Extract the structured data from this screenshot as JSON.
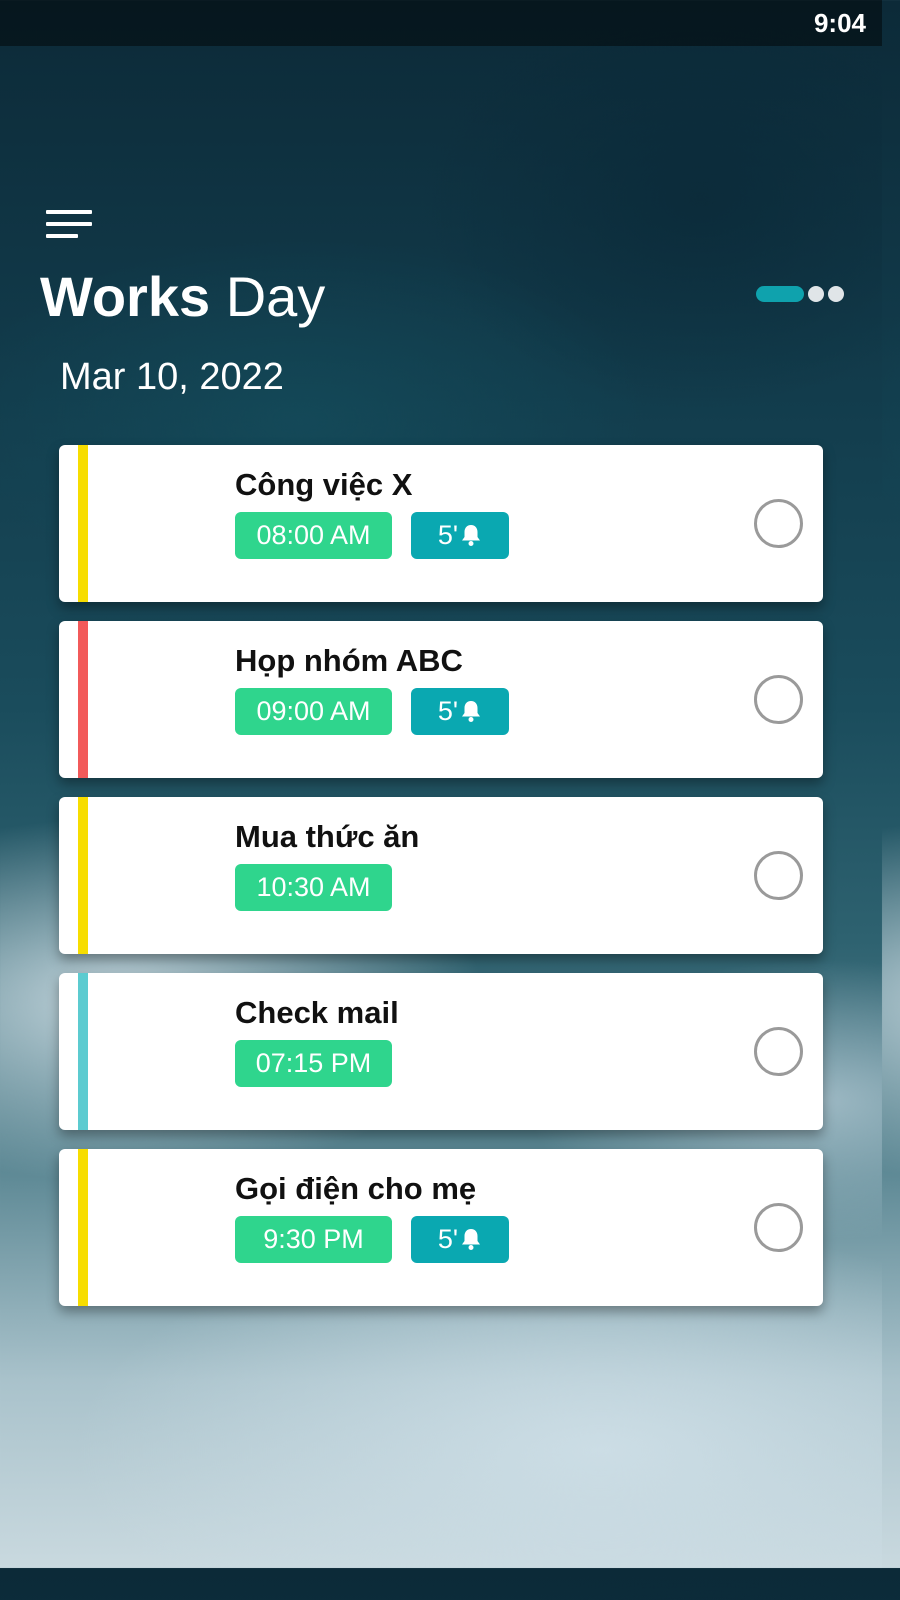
{
  "status_bar": {
    "time": "9:04"
  },
  "header": {
    "title_bold": "Works",
    "title_light": "Day",
    "date": "Mar 10, 2022"
  },
  "colors": {
    "accent_teal": "#0fa2ad",
    "time_badge": "#2fd58d",
    "reminder_badge": "#0aa8b1"
  },
  "pager": {
    "pages": 3,
    "active": 0
  },
  "tasks": [
    {
      "title": "Công việc X",
      "time": "08:00 AM",
      "reminder": "5'",
      "accent": "#f7dd00",
      "done": false
    },
    {
      "title": "Họp nhóm ABC",
      "time": "09:00 AM",
      "reminder": "5'",
      "accent": "#f25a5a",
      "done": false
    },
    {
      "title": "Mua thức ăn",
      "time": "10:30 AM",
      "reminder": "",
      "accent": "#f7dd00",
      "done": false
    },
    {
      "title": "Check mail",
      "time": "07:15 PM",
      "reminder": "",
      "accent": "#5ccbd0",
      "done": false
    },
    {
      "title": "Gọi điện cho mẹ",
      "time": "9:30 PM",
      "reminder": "5'",
      "accent": "#f7dd00",
      "done": false
    }
  ]
}
